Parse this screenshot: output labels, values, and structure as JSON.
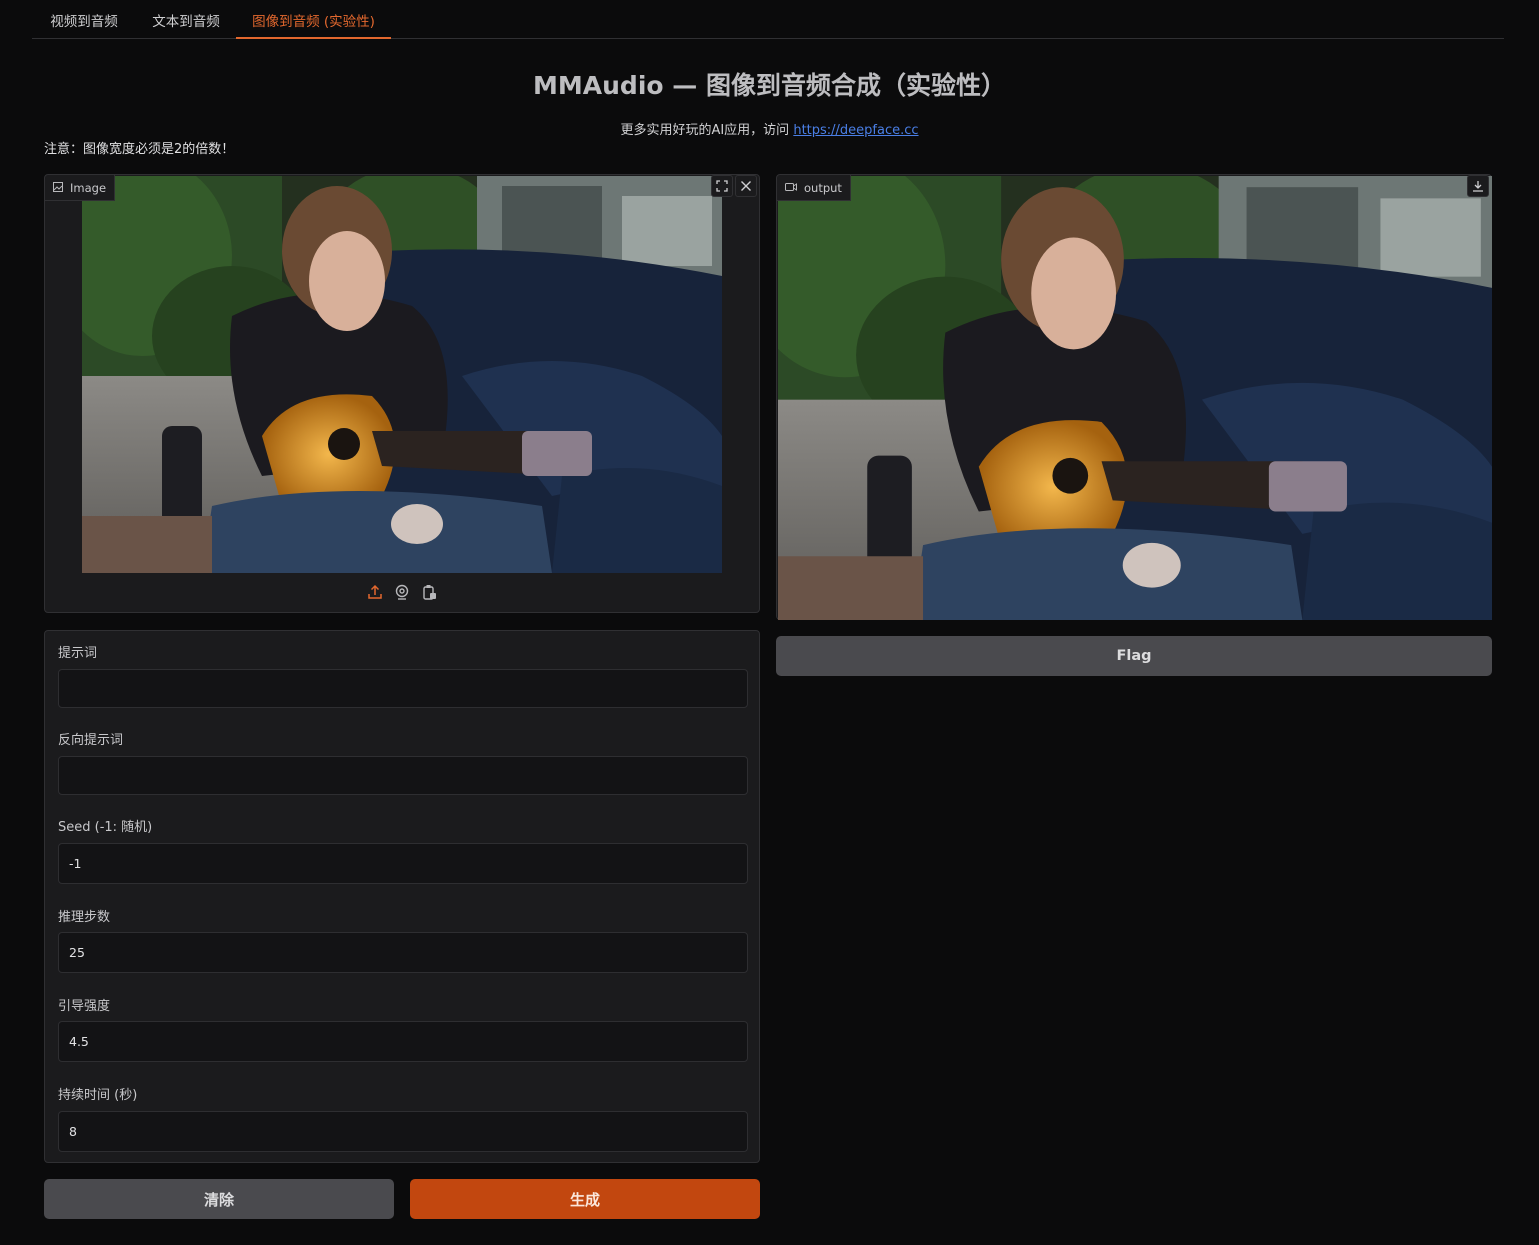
{
  "tabs": [
    {
      "label": "视频到音频",
      "active": false
    },
    {
      "label": "文本到音频",
      "active": false
    },
    {
      "label": "图像到音频 (实验性)",
      "active": true
    }
  ],
  "header": {
    "title": "MMAudio — 图像到音频合成（实验性）",
    "subtitle_text": "更多实用好玩的AI应用，访问",
    "subtitle_link": "https://deepface.cc",
    "note": "注意：图像宽度必须是2的倍数！"
  },
  "image_input": {
    "label": "Image",
    "icons": [
      "image-icon",
      "fullscreen-icon",
      "close-icon",
      "upload-icon",
      "webcam-icon",
      "clipboard-icon"
    ]
  },
  "video_output": {
    "label": "output",
    "icons": [
      "video-icon",
      "download-icon"
    ]
  },
  "form": {
    "prompt": {
      "label": "提示词",
      "value": ""
    },
    "negative_prompt": {
      "label": "反向提示词",
      "value": ""
    },
    "seed": {
      "label": "Seed (-1: 随机)",
      "value": "-1"
    },
    "steps": {
      "label": "推理步数",
      "value": "25"
    },
    "guidance": {
      "label": "引导强度",
      "value": "4.5"
    },
    "duration": {
      "label": "持续时间 (秒)",
      "value": "8"
    }
  },
  "buttons": {
    "clear": "清除",
    "generate": "生成",
    "flag": "Flag"
  },
  "colors": {
    "accent": "#e3682e",
    "primary_button": "#c2470f",
    "link": "#4a7fe6",
    "background": "#0b0b0c",
    "panel": "#1b1b1d"
  }
}
